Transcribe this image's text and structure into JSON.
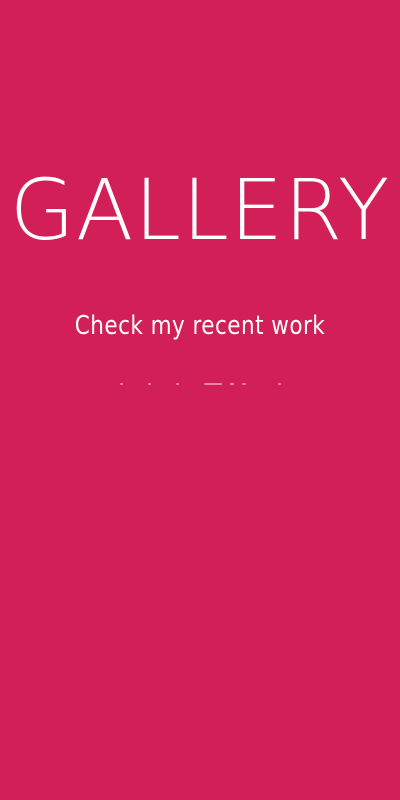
{
  "hero": {
    "title": "GALLERY",
    "subtitle": "Check my recent work"
  },
  "decoration": {
    "dot_count": 7
  },
  "colors": {
    "background": "#d21f57",
    "text": "#ffffff"
  }
}
